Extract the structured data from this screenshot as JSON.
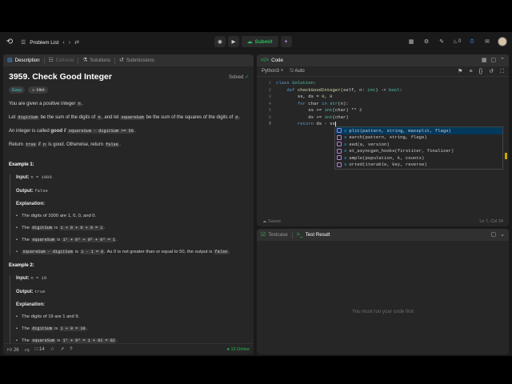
{
  "topbar": {
    "problem_list": "Problem List",
    "submit": "Submit",
    "streak_count": "0"
  },
  "left_tabs": {
    "description": "Description",
    "editorial": "Editorial",
    "solutions": "Solutions",
    "submissions": "Submissions"
  },
  "problem": {
    "title": "3959. Check Good Integer",
    "status": "Solved",
    "difficulty": "Easy",
    "hint": "Hint",
    "p1_pre": "You are given a positive integer ",
    "p1_code": "n",
    "p1_post": ".",
    "p2_a": "Let ",
    "p2_b": "digitSum",
    "p2_c": " be the sum of the digits of ",
    "p2_d": "n",
    "p2_e": ", and let ",
    "p2_f": "squareSum",
    "p2_g": " be the sum of the squares of the digits of ",
    "p2_h": "n",
    "p2_i": ".",
    "p3_a": "An integer is called ",
    "p3_b": "good",
    "p3_c": " if ",
    "p3_d": "squareSum - digitSum >= 50",
    "p3_e": ".",
    "p4_a": "Return ",
    "p4_b": "true",
    "p4_c": " if ",
    "p4_d": "n",
    "p4_e": " is good. Otherwise, return ",
    "p4_f": "false",
    "p4_g": "."
  },
  "example1": {
    "title": "Example 1:",
    "input_label": "Input:",
    "input": "n = 1000",
    "output_label": "Output:",
    "output": "false",
    "explanation_label": "Explanation:",
    "b1": "The digits of 1000 are 1, 0, 0, and 0.",
    "b2_a": "The ",
    "b2_b": "digitSum",
    "b2_c": " is ",
    "b2_d": "1 + 0 + 0 + 0 = 1",
    "b2_e": ".",
    "b3_a": "The ",
    "b3_b": "squareSum",
    "b3_c": " is ",
    "b3_d": "1² + 0² + 0² + 0² = 1",
    "b3_e": ".",
    "b4_a": "squareSum - digitSum",
    "b4_b": " is ",
    "b4_c": "1 - 1 = 0",
    "b4_d": ". As 0 is not greater than or equal to 50, the output is ",
    "b4_e": "false",
    "b4_f": "."
  },
  "example2": {
    "title": "Example 2:",
    "input_label": "Input:",
    "input": "n = 19",
    "output_label": "Output:",
    "output": "true",
    "explanation_label": "Explanation:",
    "b1": "The digits of 19 are 1 and 9.",
    "b2_a": "The ",
    "b2_b": "digitSum",
    "b2_c": " is ",
    "b2_d": "1 + 9 = 10",
    "b2_e": ".",
    "b3_a": "The ",
    "b3_b": "squareSum",
    "b3_c": " is ",
    "b3_d": "1² + 9² = 1 + 81 = 82",
    "b3_e": "."
  },
  "bottombar": {
    "likes": "26",
    "comments": "14",
    "online": "13 Online"
  },
  "code_panel": {
    "tab": "Code",
    "language": "Python3",
    "auto": "Auto",
    "saved": "Saved",
    "cursor": "Ln 7, Col 24",
    "line_numbers": [
      "1",
      "2",
      "3",
      "4",
      "5",
      "6",
      "7"
    ],
    "lines": {
      "l1_kw": "class",
      "l1_name": " Solution:",
      "l2_kw": "    def",
      "l2_fn": " checkGoodInteger",
      "l2_a": "(self, ",
      "l2_p": "n",
      "l2_b": ": ",
      "l2_t": "int",
      "l2_c": ") -> ",
      "l2_r": "bool",
      "l2_d": ":",
      "l3": "        ss, ds = ",
      "l3_n1": "0",
      "l3_m": ", ",
      "l3_n2": "0",
      "l4_kw": "        for",
      "l4_a": " char ",
      "l4_kw2": "in",
      "l4_fn": " str",
      "l4_b": "(n):",
      "l5_a": "            ss += ",
      "l5_fn": "int",
      "l5_b": "(char) ** ",
      "l5_n": "2",
      "l6_a": "            ds += ",
      "l6_fn": "int",
      "l6_b": "(char)",
      "l7_kw": "        return",
      "l7_a": " ds - ss"
    }
  },
  "autocomplete": [
    {
      "hl": "s",
      "rest": "plit(pattern, string, maxsplit, flags)"
    },
    {
      "hl": "s",
      "rest": "earch(pattern, string, flags)"
    },
    {
      "hl": "s",
      "rest": "eed(a, version)"
    },
    {
      "hl": "s",
      "rest": "et_asyncgen_hooks(firstiter, finalizer)"
    },
    {
      "hl": "s",
      "rest": "ample(population, k, counts)"
    },
    {
      "hl": "s",
      "rest": "orted(iterable, key, reverse)"
    }
  ],
  "result_panel": {
    "testcase": "Testcase",
    "test_result": "Test Result",
    "empty_message": "You must run your code first"
  },
  "colors": {
    "accent_green": "#2cbb5d",
    "easy": "#46c6c2",
    "background": "#1a1a1a",
    "panel": "#262626"
  }
}
